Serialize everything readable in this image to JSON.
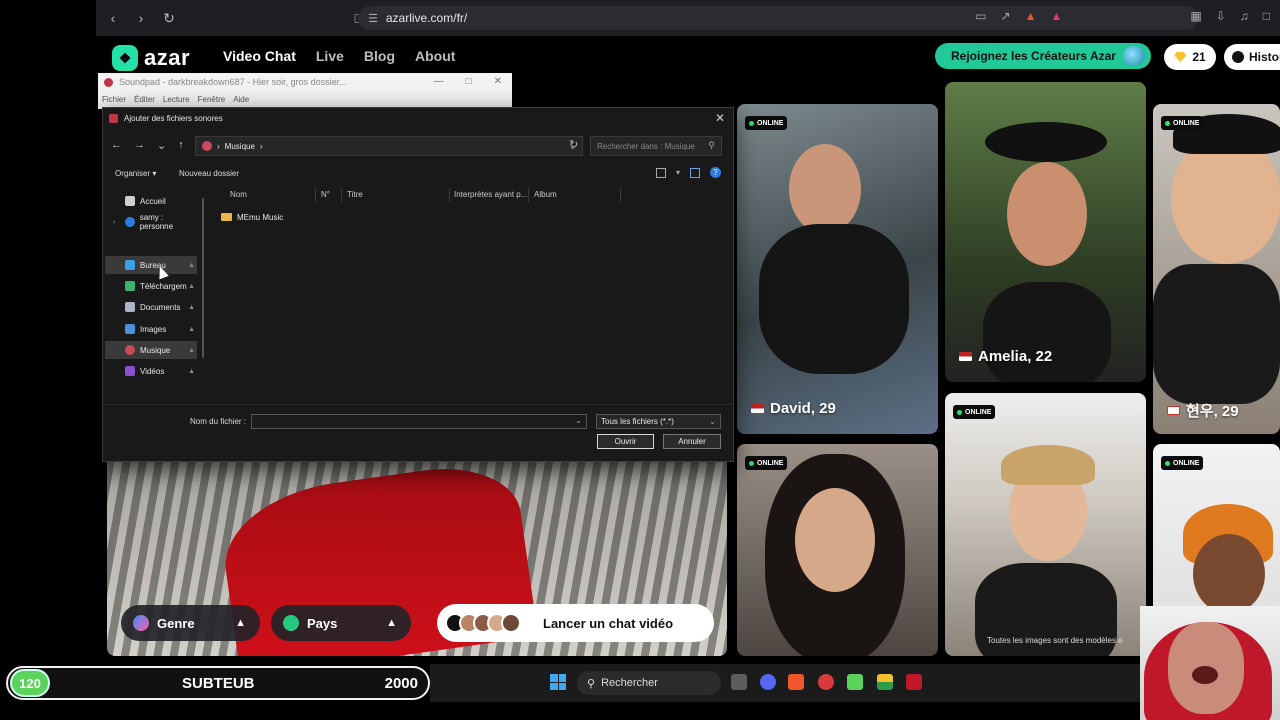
{
  "browser": {
    "url": "azarlive.com/fr/"
  },
  "azar": {
    "logo_text": "azar",
    "nav": [
      {
        "label": "Video Chat"
      },
      {
        "label": "Live"
      },
      {
        "label": "Blog"
      },
      {
        "label": "About"
      }
    ],
    "creators_button": "Rejoignez les Créateurs Azar",
    "gems_count": "21",
    "history_label": "Histor",
    "genre_label": "Genre",
    "country_label": "Pays",
    "launch_label": "Lancer un chat vidéo",
    "disclaimer": "Toutes les images sont des modèles e",
    "online_badge": "ONLINE",
    "profiles": [
      {
        "name": "David, 29",
        "flag": "us"
      },
      {
        "name": "Amelia, 22",
        "flag": "us"
      },
      {
        "name": "현우, 29",
        "flag": "kr"
      }
    ]
  },
  "soundpad": {
    "title": "Soundpad - darkbreakdown687 - Hier soir, gros dossier...",
    "menu": [
      {
        "label": "Fichier"
      },
      {
        "label": "Éditer"
      },
      {
        "label": "Lecture"
      },
      {
        "label": "Fenêtre"
      },
      {
        "label": "Aide"
      }
    ]
  },
  "dialog": {
    "title": "Ajouter des fichiers sonores",
    "breadcrumb": "Musique",
    "search_placeholder": "Rechercher dans : Musique",
    "organize_label": "Organiser",
    "new_folder_label": "Nouveau dossier",
    "sidebar": [
      {
        "label": "Accueil"
      },
      {
        "label": "samy : personne"
      },
      {
        "label": "Bureau"
      },
      {
        "label": "Téléchargem"
      },
      {
        "label": "Documents"
      },
      {
        "label": "Images"
      },
      {
        "label": "Musique"
      },
      {
        "label": "Vidéos"
      }
    ],
    "columns": [
      {
        "label": "Nom"
      },
      {
        "label": "N°"
      },
      {
        "label": "Titre"
      },
      {
        "label": "Interprètes ayant p..."
      },
      {
        "label": "Album"
      }
    ],
    "files": [
      {
        "name": "MEmu Music"
      }
    ],
    "filename_label": "Nom du fichier :",
    "filename_value": "",
    "filetype": "Tous les fichiers (*.*)",
    "open_button": "Ouvrir",
    "cancel_button": "Annuler"
  },
  "overlay": {
    "sub_count": "120",
    "sub_label": "SUBTEUB",
    "sub_goal": "2000"
  },
  "taskbar": {
    "search_label": "Rechercher"
  },
  "colors": {
    "accent_green": "#20c997",
    "online_green": "#2ee36e"
  }
}
